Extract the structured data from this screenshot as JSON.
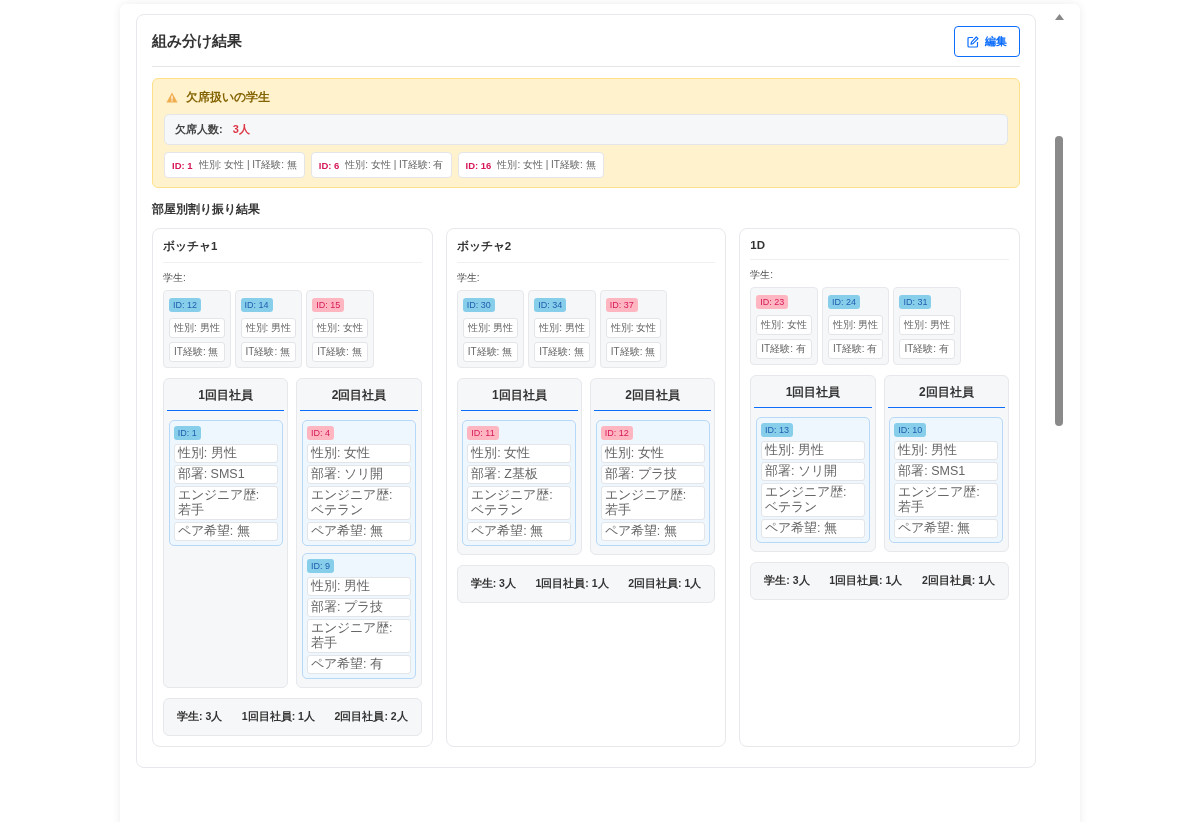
{
  "title": "組み分け結果",
  "edit_button": "編集",
  "absent": {
    "title": "欠席扱いの学生",
    "count_label": "欠席人数:",
    "count": "3人",
    "students": [
      {
        "id": "ID: 1",
        "info": "性別: 女性 | IT経験: 無"
      },
      {
        "id": "ID: 6",
        "info": "性別: 女性 | IT経験: 有"
      },
      {
        "id": "ID: 16",
        "info": "性別: 女性 | IT経験: 無"
      }
    ]
  },
  "section_title": "部屋別割り振り結果",
  "rooms": [
    {
      "name": "ボッチャ1",
      "students_label": "学生:",
      "students": [
        {
          "id": "ID: 12",
          "color": "#87ceeb",
          "fields": [
            "性別: 男性",
            "IT経験: 無"
          ]
        },
        {
          "id": "ID: 14",
          "color": "#87ceeb",
          "fields": [
            "性別: 男性",
            "IT経験: 無"
          ]
        },
        {
          "id": "ID: 15",
          "color": "#ffb6c1",
          "fields": [
            "性別: 女性",
            "IT経験: 無"
          ]
        }
      ],
      "groups": [
        {
          "title": "1回目社員",
          "members": [
            {
              "id": "ID: 1",
              "color": "#87ceeb",
              "fields": [
                "性別: 男性",
                "部署: SMS1",
                "エンジニア歴: 若手",
                "ペア希望: 無"
              ]
            }
          ]
        },
        {
          "title": "2回目社員",
          "members": [
            {
              "id": "ID: 4",
              "color": "#ffb6c1",
              "fields": [
                "性別: 女性",
                "部署: ソリ開",
                "エンジニア歴: ベテラン",
                "ペア希望: 無"
              ]
            },
            {
              "id": "ID: 9",
              "color": "#87ceeb",
              "fields": [
                "性別: 男性",
                "部署: プラ技",
                "エンジニア歴: 若手",
                "ペア希望: 有"
              ]
            }
          ]
        }
      ],
      "summary": [
        "学生: 3人",
        "1回目社員: 1人",
        "2回目社員: 2人"
      ]
    },
    {
      "name": "ボッチャ2",
      "students_label": "学生:",
      "students": [
        {
          "id": "ID: 30",
          "color": "#87ceeb",
          "fields": [
            "性別: 男性",
            "IT経験: 無"
          ]
        },
        {
          "id": "ID: 34",
          "color": "#87ceeb",
          "fields": [
            "性別: 男性",
            "IT経験: 無"
          ]
        },
        {
          "id": "ID: 37",
          "color": "#ffb6c1",
          "fields": [
            "性別: 女性",
            "IT経験: 無"
          ]
        }
      ],
      "groups": [
        {
          "title": "1回目社員",
          "members": [
            {
              "id": "ID: 11",
              "color": "#ffb6c1",
              "fields": [
                "性別: 女性",
                "部署: Z基板",
                "エンジニア歴: ベテラン",
                "ペア希望: 無"
              ]
            }
          ]
        },
        {
          "title": "2回目社員",
          "members": [
            {
              "id": "ID: 12",
              "color": "#ffb6c1",
              "fields": [
                "性別: 女性",
                "部署: プラ技",
                "エンジニア歴: 若手",
                "ペア希望: 無"
              ]
            }
          ]
        }
      ],
      "summary": [
        "学生: 3人",
        "1回目社員: 1人",
        "2回目社員: 1人"
      ]
    },
    {
      "name": "1D",
      "students_label": "学生:",
      "students": [
        {
          "id": "ID: 23",
          "color": "#ffb6c1",
          "fields": [
            "性別: 女性",
            "IT経験: 有"
          ]
        },
        {
          "id": "ID: 24",
          "color": "#87ceeb",
          "fields": [
            "性別: 男性",
            "IT経験: 有"
          ]
        },
        {
          "id": "ID: 31",
          "color": "#87ceeb",
          "fields": [
            "性別: 男性",
            "IT経験: 有"
          ]
        }
      ],
      "groups": [
        {
          "title": "1回目社員",
          "members": [
            {
              "id": "ID: 13",
              "color": "#87ceeb",
              "fields": [
                "性別: 男性",
                "部署: ソリ開",
                "エンジニア歴: ベテラン",
                "ペア希望: 無"
              ]
            }
          ]
        },
        {
          "title": "2回目社員",
          "members": [
            {
              "id": "ID: 10",
              "color": "#87ceeb",
              "fields": [
                "性別: 男性",
                "部署: SMS1",
                "エンジニア歴: 若手",
                "ペア希望: 無"
              ]
            }
          ]
        }
      ],
      "summary": [
        "学生: 3人",
        "1回目社員: 1人",
        "2回目社員: 1人"
      ]
    }
  ]
}
